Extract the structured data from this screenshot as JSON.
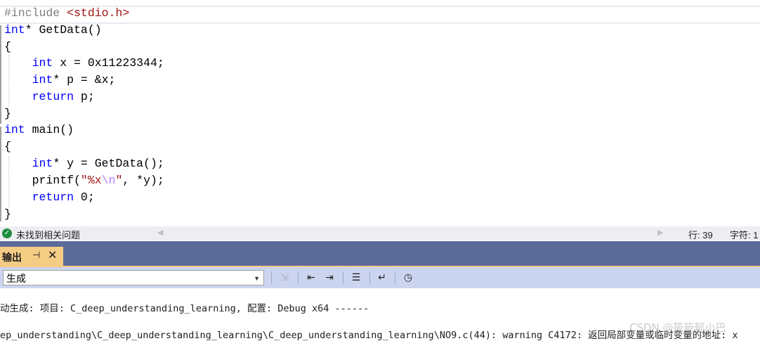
{
  "editor": {
    "lines": [
      [
        {
          "c": "pp",
          "t": "#include "
        },
        {
          "c": "str",
          "t": "<stdio.h>"
        }
      ],
      [
        {
          "c": "kw",
          "t": "int"
        },
        {
          "c": "",
          "t": "* GetData()"
        }
      ],
      [
        {
          "c": "",
          "t": "{"
        }
      ],
      [
        {
          "c": "",
          "t": "    "
        },
        {
          "c": "kw",
          "t": "int"
        },
        {
          "c": "",
          "t": " x = 0x11223344;"
        }
      ],
      [
        {
          "c": "",
          "t": "    "
        },
        {
          "c": "kw",
          "t": "int"
        },
        {
          "c": "",
          "t": "* p = &x;"
        }
      ],
      [
        {
          "c": "",
          "t": "    "
        },
        {
          "c": "kw",
          "t": "return"
        },
        {
          "c": "",
          "t": " p;"
        }
      ],
      [
        {
          "c": "",
          "t": "}"
        }
      ],
      [
        {
          "c": "kw",
          "t": "int"
        },
        {
          "c": "",
          "t": " main()"
        }
      ],
      [
        {
          "c": "",
          "t": "{"
        }
      ],
      [
        {
          "c": "",
          "t": "    "
        },
        {
          "c": "kw",
          "t": "int"
        },
        {
          "c": "",
          "t": "* y = GetData();"
        }
      ],
      [
        {
          "c": "",
          "t": "    printf("
        },
        {
          "c": "str",
          "t": "\"%x"
        },
        {
          "c": "esc",
          "t": "\\n"
        },
        {
          "c": "str",
          "t": "\""
        },
        {
          "c": "",
          "t": ", *y);"
        }
      ],
      [
        {
          "c": "",
          "t": "    "
        },
        {
          "c": "kw",
          "t": "return"
        },
        {
          "c": "",
          "t": " 0;"
        }
      ],
      [
        {
          "c": "",
          "t": "}"
        }
      ]
    ]
  },
  "status": {
    "message": "未找到相关问题",
    "line": "行: 39",
    "char": "字符: 1"
  },
  "output_panel": {
    "tab_label": "输出",
    "source_label": "生成",
    "lines": [
      "动生成: 项目: C_deep_understanding_learning, 配置: Debug x64 ------",
      "ep_understanding\\C_deep_understanding_learning\\C_deep_understanding_learning\\NO9.c(44): warning C4172: 返回局部变量或临时变量的地址: x"
    ]
  },
  "watermark": "CSDN @筱筱郁小巴",
  "colors": {
    "keyword": "#0000ff",
    "string": "#a31515",
    "preprocessor": "#808080",
    "panel_title": "#5d6b99",
    "active_tab": "#f5cc84"
  }
}
